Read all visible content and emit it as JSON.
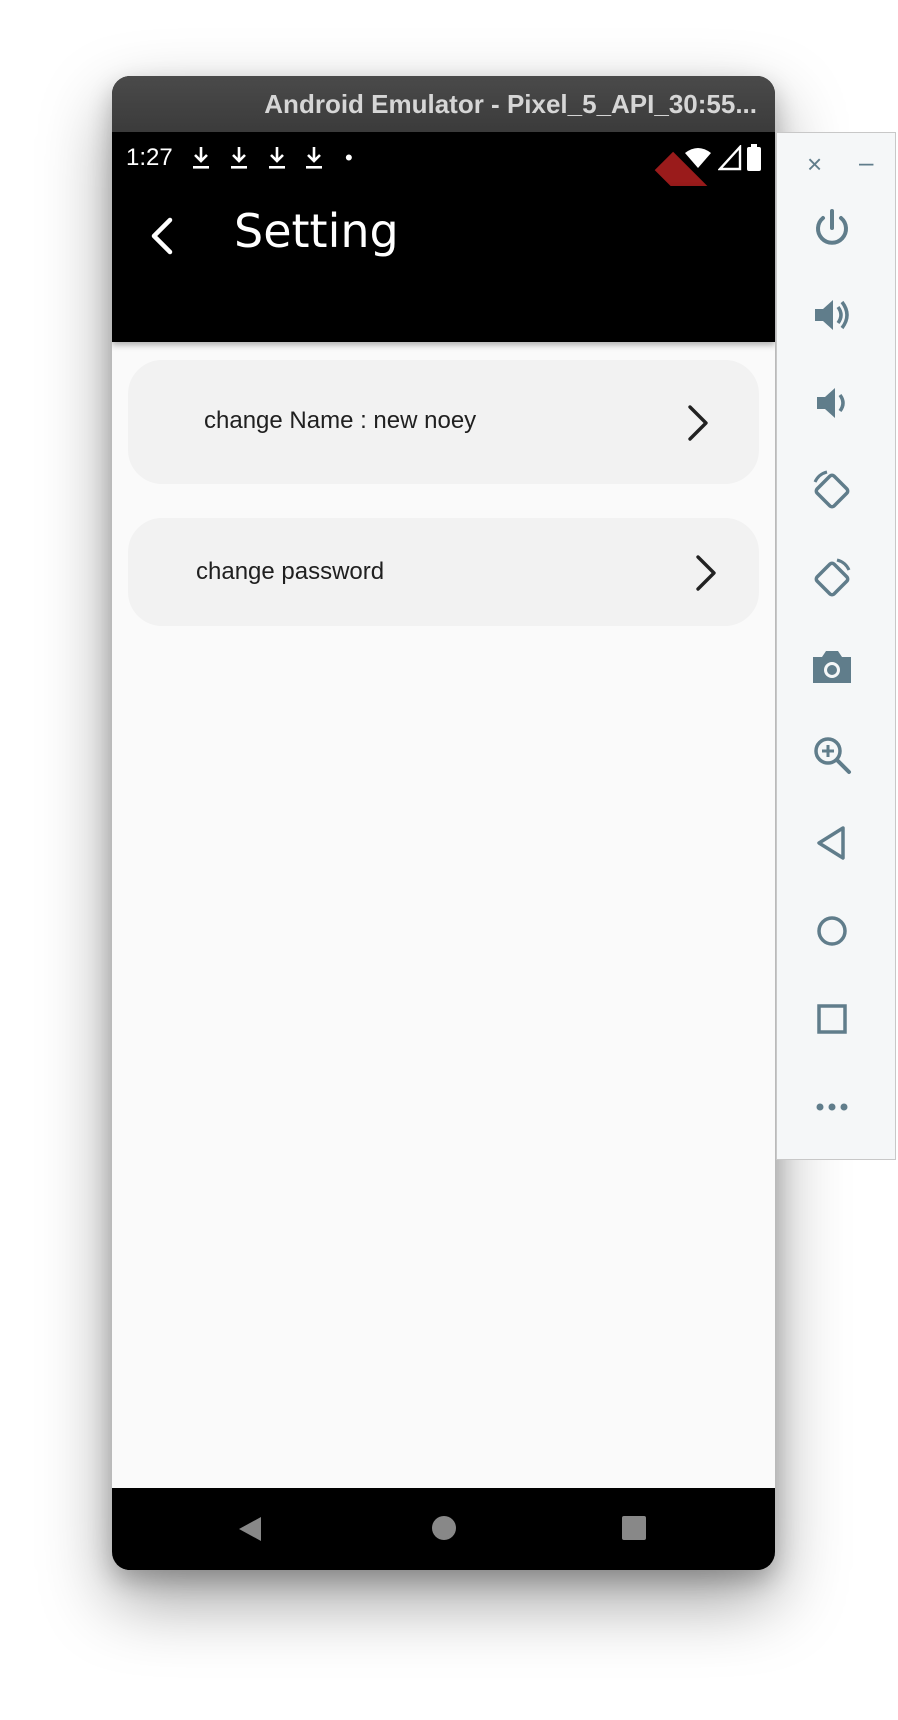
{
  "window": {
    "title": "Android Emulator - Pixel_5_API_30:55..."
  },
  "status_bar": {
    "time": "1:27",
    "notification_icons": [
      "download-icon",
      "download-icon",
      "download-icon",
      "download-icon"
    ],
    "dot": "•",
    "debug_banner": "DEBUG"
  },
  "app_bar": {
    "title": "Setting"
  },
  "settings": {
    "items": [
      {
        "label": "change Name : new noey",
        "icon": "chevron-right-icon"
      },
      {
        "label": "change password",
        "icon": "chevron-right-icon"
      }
    ]
  },
  "nav_bar": {
    "buttons": [
      "back-triangle-icon",
      "home-circle-icon",
      "recents-square-icon"
    ]
  },
  "toolbar": {
    "close": "×",
    "minimize": "–",
    "buttons": [
      "power",
      "volume-up",
      "volume-down",
      "rotate-left",
      "rotate-right",
      "screenshot",
      "zoom",
      "back",
      "home",
      "overview",
      "more"
    ]
  },
  "colors": {
    "accent": "#607d8b",
    "debug_banner": "#9a1b1b",
    "item_background": "#f2f2f2",
    "page_background": "#fafafa"
  }
}
